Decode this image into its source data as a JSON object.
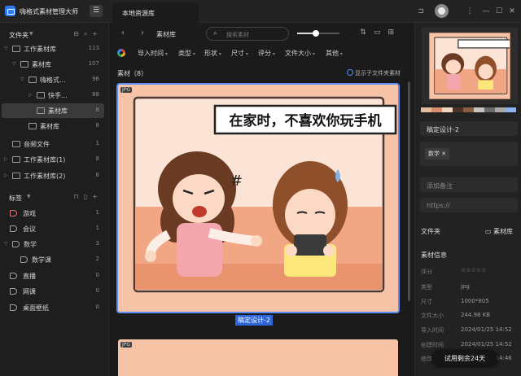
{
  "app": {
    "title": "嗨格式素材管理大师",
    "menu_glyph": "☰"
  },
  "tab": {
    "label": "本地资源库"
  },
  "window": {
    "controls": [
      "—",
      "☐",
      "✕"
    ]
  },
  "sidebar": {
    "folders_title": "文件夹",
    "folders": [
      {
        "label": "工作素材库",
        "count": "113"
      },
      {
        "label": "素材库",
        "count": "107"
      },
      {
        "label": "嗨格式...",
        "count": "96"
      },
      {
        "label": "快手...",
        "count": "88"
      },
      {
        "label": "素材库",
        "count": "8"
      },
      {
        "label": "素材库",
        "count": "8"
      },
      {
        "label": "音频文件",
        "count": "1"
      },
      {
        "label": "工作素材库(1)",
        "count": "8"
      },
      {
        "label": "工作素材库(2)",
        "count": "8"
      }
    ],
    "tags_title": "标签",
    "tags": [
      {
        "label": "游戏",
        "count": "1"
      },
      {
        "label": "会议",
        "count": "1"
      },
      {
        "label": "数学",
        "count": "3"
      },
      {
        "label": "数学课",
        "count": "2"
      },
      {
        "label": "直播",
        "count": "0"
      },
      {
        "label": "网课",
        "count": "0"
      },
      {
        "label": "桌面壁纸",
        "count": "0"
      }
    ]
  },
  "toolbar": {
    "back": "‹",
    "forward": "›",
    "breadcrumb": "素材库",
    "search_placeholder": "搜索素材",
    "zoom_fraction": 0.45
  },
  "filters": [
    "导入时间",
    "类型",
    "形状",
    "尺寸",
    "评分",
    "文件大小",
    "其他"
  ],
  "section": {
    "title": "素材（8）",
    "subfolder_toggle": "显示子文件夹素材"
  },
  "card": {
    "badge": "JPG",
    "name": "稿定设计-2",
    "speech": "在家时，不喜欢你玩手机",
    "second_badge": "JPG"
  },
  "details": {
    "palette": [
      "#e4bca1",
      "#d68e6a",
      "#f1d6c0",
      "#4a3228",
      "#8c5e3e",
      "#c9c3bd",
      "#6b6b6b",
      "#a9a9a9",
      "#8ab4f0"
    ],
    "name": "稿定设计-2",
    "tag": "数学",
    "tag_remove": "✕",
    "note_placeholder": "添加备注",
    "url_placeholder": "https://",
    "folder_label": "文件夹",
    "folder_value": "素材库",
    "info_title": "素材信息",
    "rows": [
      {
        "k": "评分",
        "v": "☆☆☆☆☆"
      },
      {
        "k": "类型",
        "v": "jpg"
      },
      {
        "k": "尺寸",
        "v": "1000*805"
      },
      {
        "k": "文件大小",
        "v": "244.98 KB"
      },
      {
        "k": "导入时间",
        "v": "2024/01/25 14:52"
      },
      {
        "k": "创建时间",
        "v": "2024/01/25 14:52"
      },
      {
        "k": "修改时间",
        "v": "2024/01/25 14:46"
      }
    ]
  },
  "trial": {
    "label": "试用剩余24天"
  }
}
